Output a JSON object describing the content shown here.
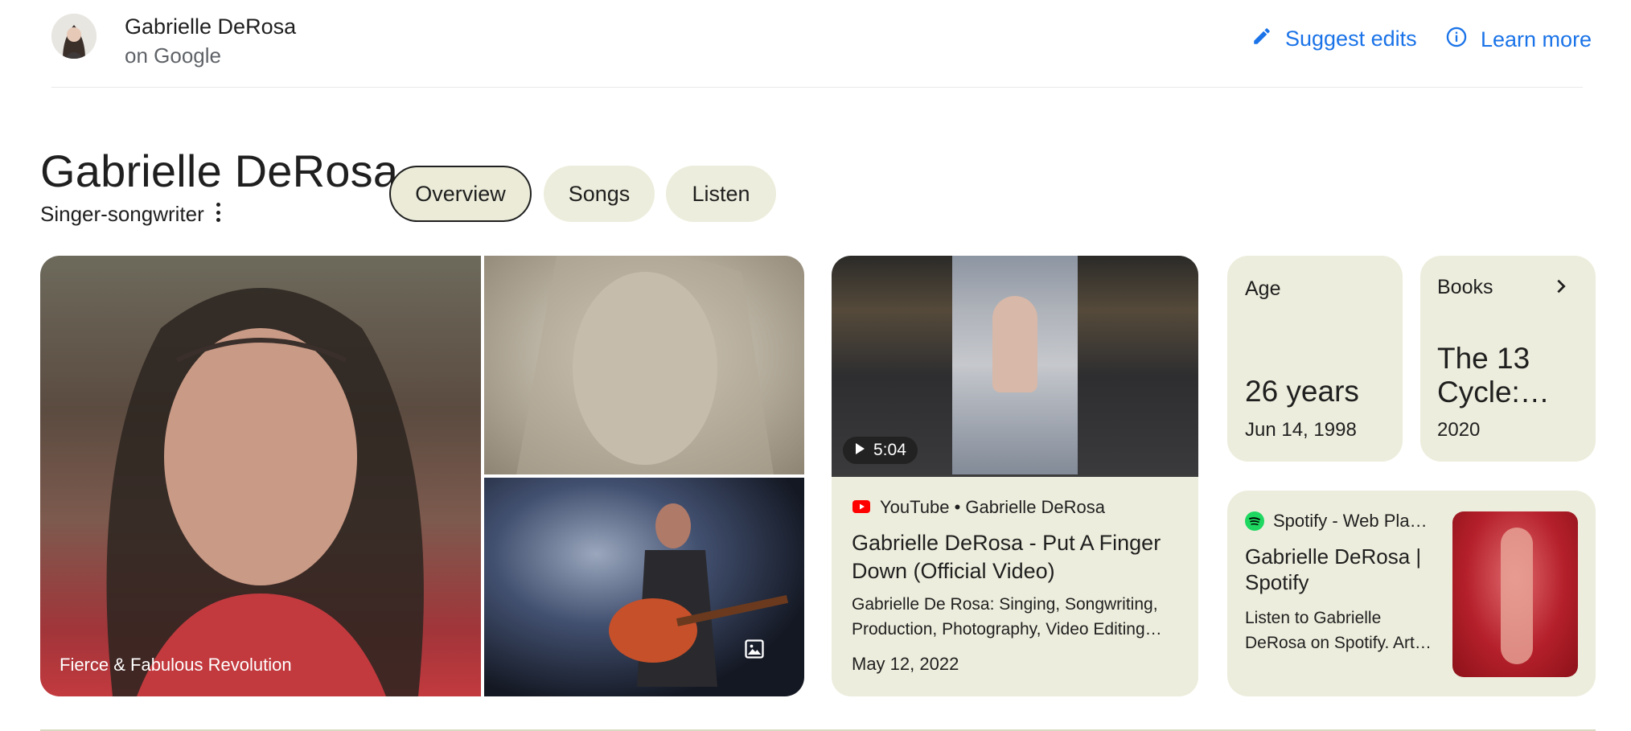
{
  "header": {
    "name": "Gabrielle DeRosa",
    "sub": "on Google",
    "suggest_edits": "Suggest edits",
    "learn_more": "Learn more"
  },
  "entity": {
    "title": "Gabrielle DeRosa",
    "subtitle": "Singer-songwriter"
  },
  "tabs": [
    {
      "label": "Overview",
      "selected": true
    },
    {
      "label": "Songs",
      "selected": false
    },
    {
      "label": "Listen",
      "selected": false
    }
  ],
  "images": {
    "caption": "Fierce & Fabulous Revolution"
  },
  "video": {
    "duration": "5:04",
    "source": "YouTube • Gabrielle DeRosa",
    "title": "Gabrielle DeRosa - Put A Finger Down (Official Video)",
    "description": "Gabrielle De Rosa: Singing, Songwriting, Production, Photography, Video Editing…",
    "date": "May 12, 2022"
  },
  "age": {
    "label": "Age",
    "value": "26 years",
    "date": "Jun 14, 1998"
  },
  "books": {
    "label": "Books",
    "title": "The 13 Cycle:…",
    "year": "2020"
  },
  "spotify": {
    "source": "Spotify - Web Playe...",
    "title": "Gabrielle DeRosa | Spotify",
    "description": "Listen to Gabrielle DeRosa on Spotify. Art…"
  },
  "colors": {
    "link": "#1a73e8",
    "chip_bg": "#ededdd",
    "card_bg": "#ededdd",
    "youtube_red": "#ff0000",
    "spotify_green": "#1ed760"
  }
}
